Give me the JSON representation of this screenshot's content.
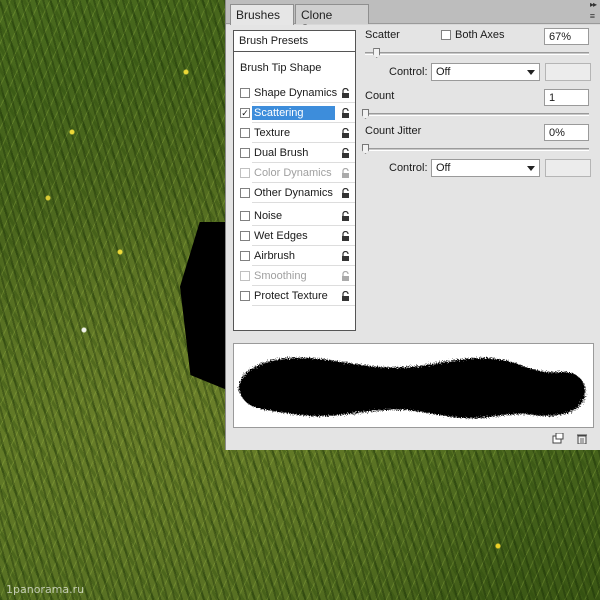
{
  "tabs": [
    {
      "label": "Brushes",
      "close": "×"
    },
    {
      "label": "Clone Source"
    }
  ],
  "panel_menu": "▸▸",
  "panel_menu_icon": "≡",
  "brush_presets": "Brush Presets",
  "brush_tip_shape": "Brush Tip Shape",
  "options": [
    {
      "label": "Shape Dynamics",
      "checked": false,
      "enabled": true
    },
    {
      "label": "Scattering",
      "checked": true,
      "enabled": true,
      "selected": true
    },
    {
      "label": "Texture",
      "checked": false,
      "enabled": true
    },
    {
      "label": "Dual Brush",
      "checked": false,
      "enabled": true
    },
    {
      "label": "Color Dynamics",
      "checked": false,
      "enabled": false
    },
    {
      "label": "Other Dynamics",
      "checked": false,
      "enabled": true
    },
    {
      "label": "Noise",
      "checked": false,
      "enabled": true
    },
    {
      "label": "Wet Edges",
      "checked": false,
      "enabled": true
    },
    {
      "label": "Airbrush",
      "checked": false,
      "enabled": true
    },
    {
      "label": "Smoothing",
      "checked": false,
      "enabled": false
    },
    {
      "label": "Protect Texture",
      "checked": false,
      "enabled": true
    }
  ],
  "scattering": {
    "scatter_label": "Scatter",
    "both_axes_label": "Both Axes",
    "scatter_value": "67%",
    "control_label": "Control:",
    "control_value": "Off",
    "count_label": "Count",
    "count_value": "1",
    "count_jitter_label": "Count Jitter",
    "count_jitter_value": "0%",
    "control2_label": "Control:",
    "control2_value": "Off",
    "scatter_slider_level": 0.05,
    "count_slider_level": 0,
    "count_jitter_slider_level": 0
  },
  "watermark": "1panorama.ru",
  "check_mark": "✓",
  "colors": {
    "selection": "#3d8ddb",
    "panel": "#e4e4e4"
  },
  "icons": [
    "lock-icon",
    "new-brush-icon",
    "trash-icon",
    "chevron-down-icon",
    "panel-menu-icon"
  ]
}
